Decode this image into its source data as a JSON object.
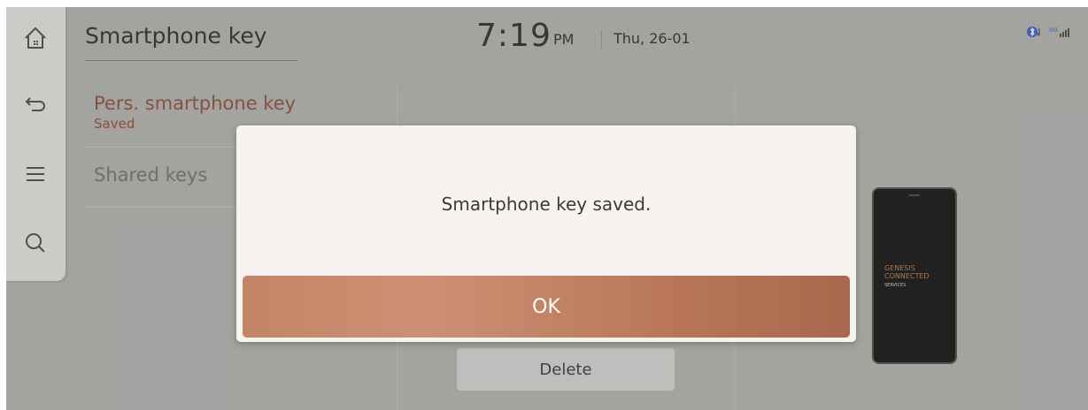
{
  "header": {
    "title": "Smartphone key",
    "time": "7:19",
    "ampm": "PM",
    "date": "Thu, 26-01"
  },
  "sidebar": {
    "items": [
      {
        "icon": "home-icon"
      },
      {
        "icon": "back-icon"
      },
      {
        "icon": "menu-icon"
      },
      {
        "icon": "search-icon"
      }
    ]
  },
  "menu": {
    "personal_key_label": "Pers. smartphone key",
    "personal_key_status": "Saved",
    "shared_keys_label": "Shared keys"
  },
  "actions": {
    "delete_label": "Delete"
  },
  "phone": {
    "brand_line1": "GENESIS",
    "brand_line2": "CONNECTED",
    "brand_line3": "SERVICES"
  },
  "dialog": {
    "message": "Smartphone key saved.",
    "ok_label": "OK"
  },
  "colors": {
    "accent": "#8a4b36",
    "ok_button": "#c48565",
    "background": "#a9a9a7"
  }
}
